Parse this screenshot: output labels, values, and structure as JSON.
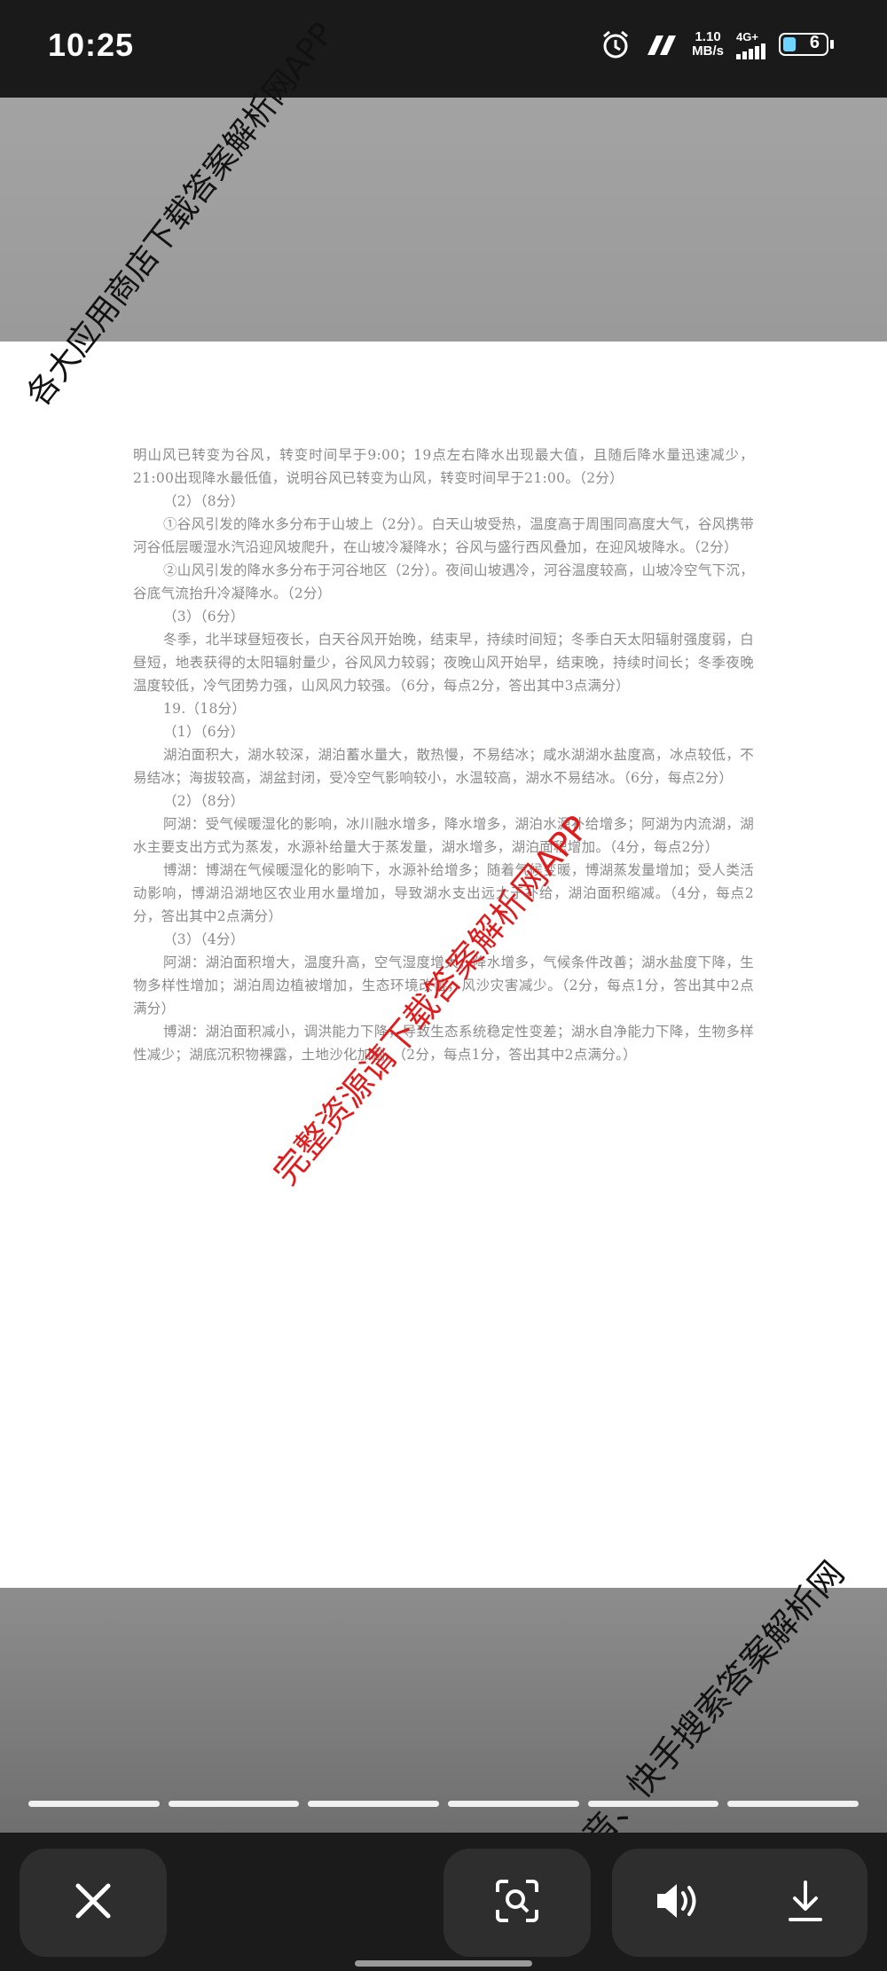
{
  "status_bar": {
    "time": "10:25",
    "net_speed_value": "1.10",
    "net_speed_unit": "MB/s",
    "signal_label": "4G+",
    "battery_level": "6",
    "icons": [
      "alarm-icon",
      "hd-voice-icon",
      "signal-icon",
      "battery-icon"
    ]
  },
  "document": {
    "paragraphs": [
      {
        "indent": false,
        "text": "明山风已转变为谷风，转变时间早于9:00；19点左右降水出现最大值，且随后降水量迅速减少，21:00出现降水最低值，说明谷风已转变为山风，转变时间早于21:00。（2分）"
      },
      {
        "indent": true,
        "text": "（2）（8分）"
      },
      {
        "indent": true,
        "text": "①谷风引发的降水多分布于山坡上（2分）。白天山坡受热，温度高于周围同高度大气，谷风携带河谷低层暖湿水汽沿迎风坡爬升，在山坡冷凝降水；谷风与盛行西风叠加，在迎风坡降水。（2分）"
      },
      {
        "indent": true,
        "text": "②山风引发的降水多分布于河谷地区（2分）。夜间山坡遇冷，河谷温度较高，山坡冷空气下沉，谷底气流抬升冷凝降水。（2分）"
      },
      {
        "indent": true,
        "text": "（3）（6分）"
      },
      {
        "indent": true,
        "text": "冬季，北半球昼短夜长，白天谷风开始晚，结束早，持续时间短；冬季白天太阳辐射强度弱，白昼短，地表获得的太阳辐射量少，谷风风力较弱；夜晚山风开始早，结束晚，持续时间长；冬季夜晚温度较低，冷气团势力强，山风风力较强。（6分，每点2分，答出其中3点满分）"
      },
      {
        "indent": true,
        "text": "19.（18分）"
      },
      {
        "indent": true,
        "text": "（1）（6分）"
      },
      {
        "indent": true,
        "text": "湖泊面积大，湖水较深，湖泊蓄水量大，散热慢，不易结冰；咸水湖湖水盐度高，冰点较低，不易结冰；海拔较高，湖盆封闭，受冷空气影响较小，水温较高，湖水不易结冰。（6分，每点2分）"
      },
      {
        "indent": true,
        "text": "（2）（8分）"
      },
      {
        "indent": true,
        "text": "阿湖：受气候暖湿化的影响，冰川融水增多，降水增多，湖泊水源补给增多；阿湖为内流湖，湖水主要支出方式为蒸发，水源补给量大于蒸发量，湖水增多，湖泊面积增加。（4分，每点2分）"
      },
      {
        "indent": true,
        "text": "博湖：博湖在气候暖湿化的影响下，水源补给增多；随着气候变暖，博湖蒸发量增加；受人类活动影响，博湖沿湖地区农业用水量增加，导致湖水支出远大于补给，湖泊面积缩减。（4分，每点2分，答出其中2点满分）"
      },
      {
        "indent": true,
        "text": "（3）（4分）"
      },
      {
        "indent": true,
        "text": "阿湖：湖泊面积增大，温度升高，空气湿度增大，降水增多，气候条件改善；湖水盐度下降，生物多样性增加；湖泊周边植被增加，生态环境改善，风沙灾害减少。（2分，每点1分，答出其中2点满分）"
      },
      {
        "indent": true,
        "text": "博湖：湖泊面积减小，调洪能力下降，导致生态系统稳定性变差；湖水自净能力下降，生物多样性减少；湖底沉积物裸露，土地沙化加剧。（2分，每点1分，答出其中2点满分。）"
      }
    ]
  },
  "watermarks": {
    "top": "各大应用商店下载答案解析网APP",
    "center": "完整资源请下载答案解析网APP",
    "bottom": "微信、抖音、快手搜索答案解析网"
  },
  "progress": {
    "segments": 6
  },
  "toolbar": {
    "buttons": [
      "close-icon",
      "lens-icon",
      "volume-icon",
      "download-icon"
    ]
  }
}
